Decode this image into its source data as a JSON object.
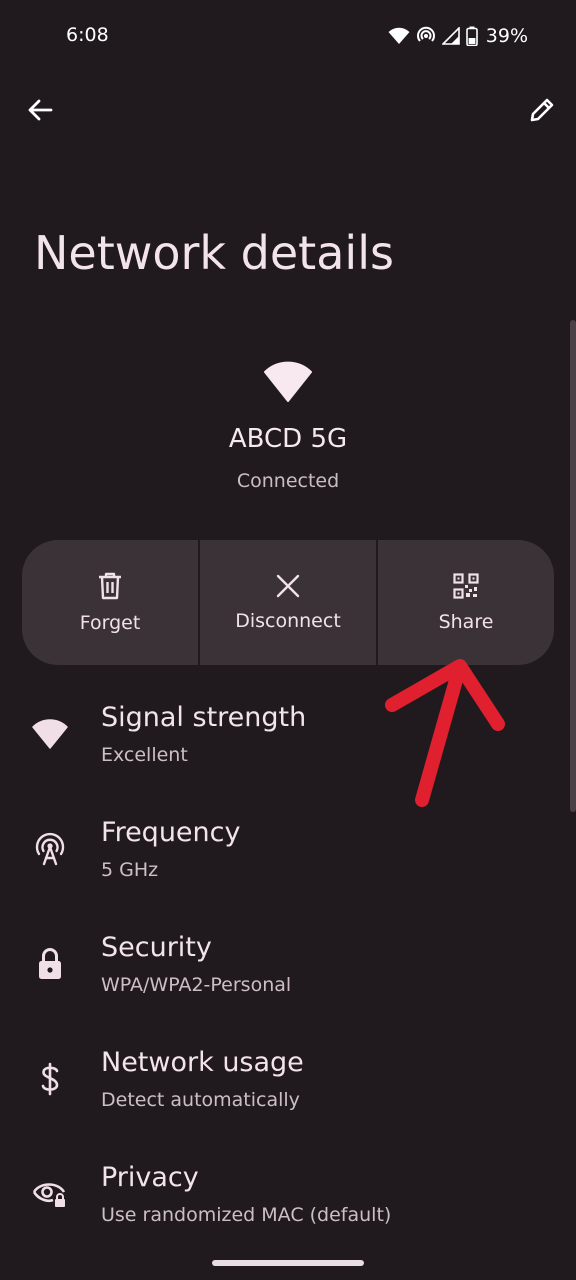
{
  "status_bar": {
    "time": "6:08",
    "battery": "39%"
  },
  "page": {
    "title": "Network details"
  },
  "network": {
    "name": "ABCD 5G",
    "state": "Connected"
  },
  "actions": [
    {
      "label": "Forget",
      "icon": "trash-icon"
    },
    {
      "label": "Disconnect",
      "icon": "close-icon"
    },
    {
      "label": "Share",
      "icon": "qr-code-icon"
    }
  ],
  "details": [
    {
      "title": "Signal strength",
      "value": "Excellent",
      "icon": "wifi-icon"
    },
    {
      "title": "Frequency",
      "value": "5 GHz",
      "icon": "antenna-icon"
    },
    {
      "title": "Security",
      "value": "WPA/WPA2-Personal",
      "icon": "lock-icon"
    },
    {
      "title": "Network usage",
      "value": "Detect automatically",
      "icon": "dollar-icon"
    },
    {
      "title": "Privacy",
      "value": "Use randomized MAC (default)",
      "icon": "eye-lock-icon"
    }
  ],
  "colors": {
    "background": "#201a1e",
    "surface": "#3a3237",
    "annotation": "#e0202e"
  }
}
